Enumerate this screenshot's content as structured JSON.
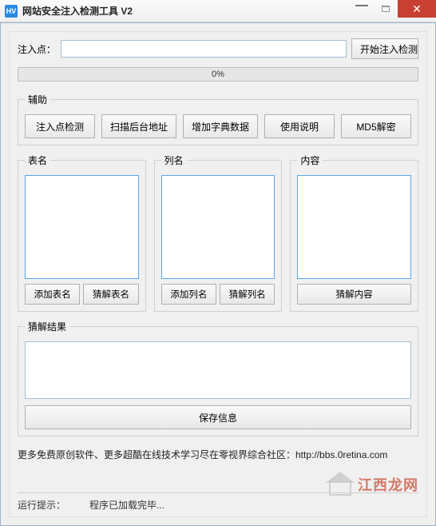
{
  "window": {
    "icon_text": "HV",
    "title": "网站安全注入检测工具 V2"
  },
  "top": {
    "label": "注入点：",
    "url_value": "",
    "start_btn": "开始注入检测"
  },
  "progress": {
    "text": "0%"
  },
  "aux": {
    "legend": "辅助",
    "btns": [
      "注入点检测",
      "扫描后台地址",
      "增加字典数据",
      "使用说明",
      "MD5解密"
    ]
  },
  "cols": {
    "table": {
      "legend": "表名",
      "add": "添加表名",
      "guess": "猜解表名"
    },
    "column": {
      "legend": "列名",
      "add": "添加列名",
      "guess": "猜解列名"
    },
    "content": {
      "legend": "内容",
      "guess": "猜解内容"
    }
  },
  "result": {
    "legend": "猜解结果",
    "save": "保存信息"
  },
  "footer_note": "更多免费原创软件、更多超酷在线技术学习尽在零视界综合社区：http://bbs.0retina.com",
  "status": {
    "label": "运行提示：",
    "msg": "程序已加载完毕..."
  },
  "watermark": "江西龙网"
}
